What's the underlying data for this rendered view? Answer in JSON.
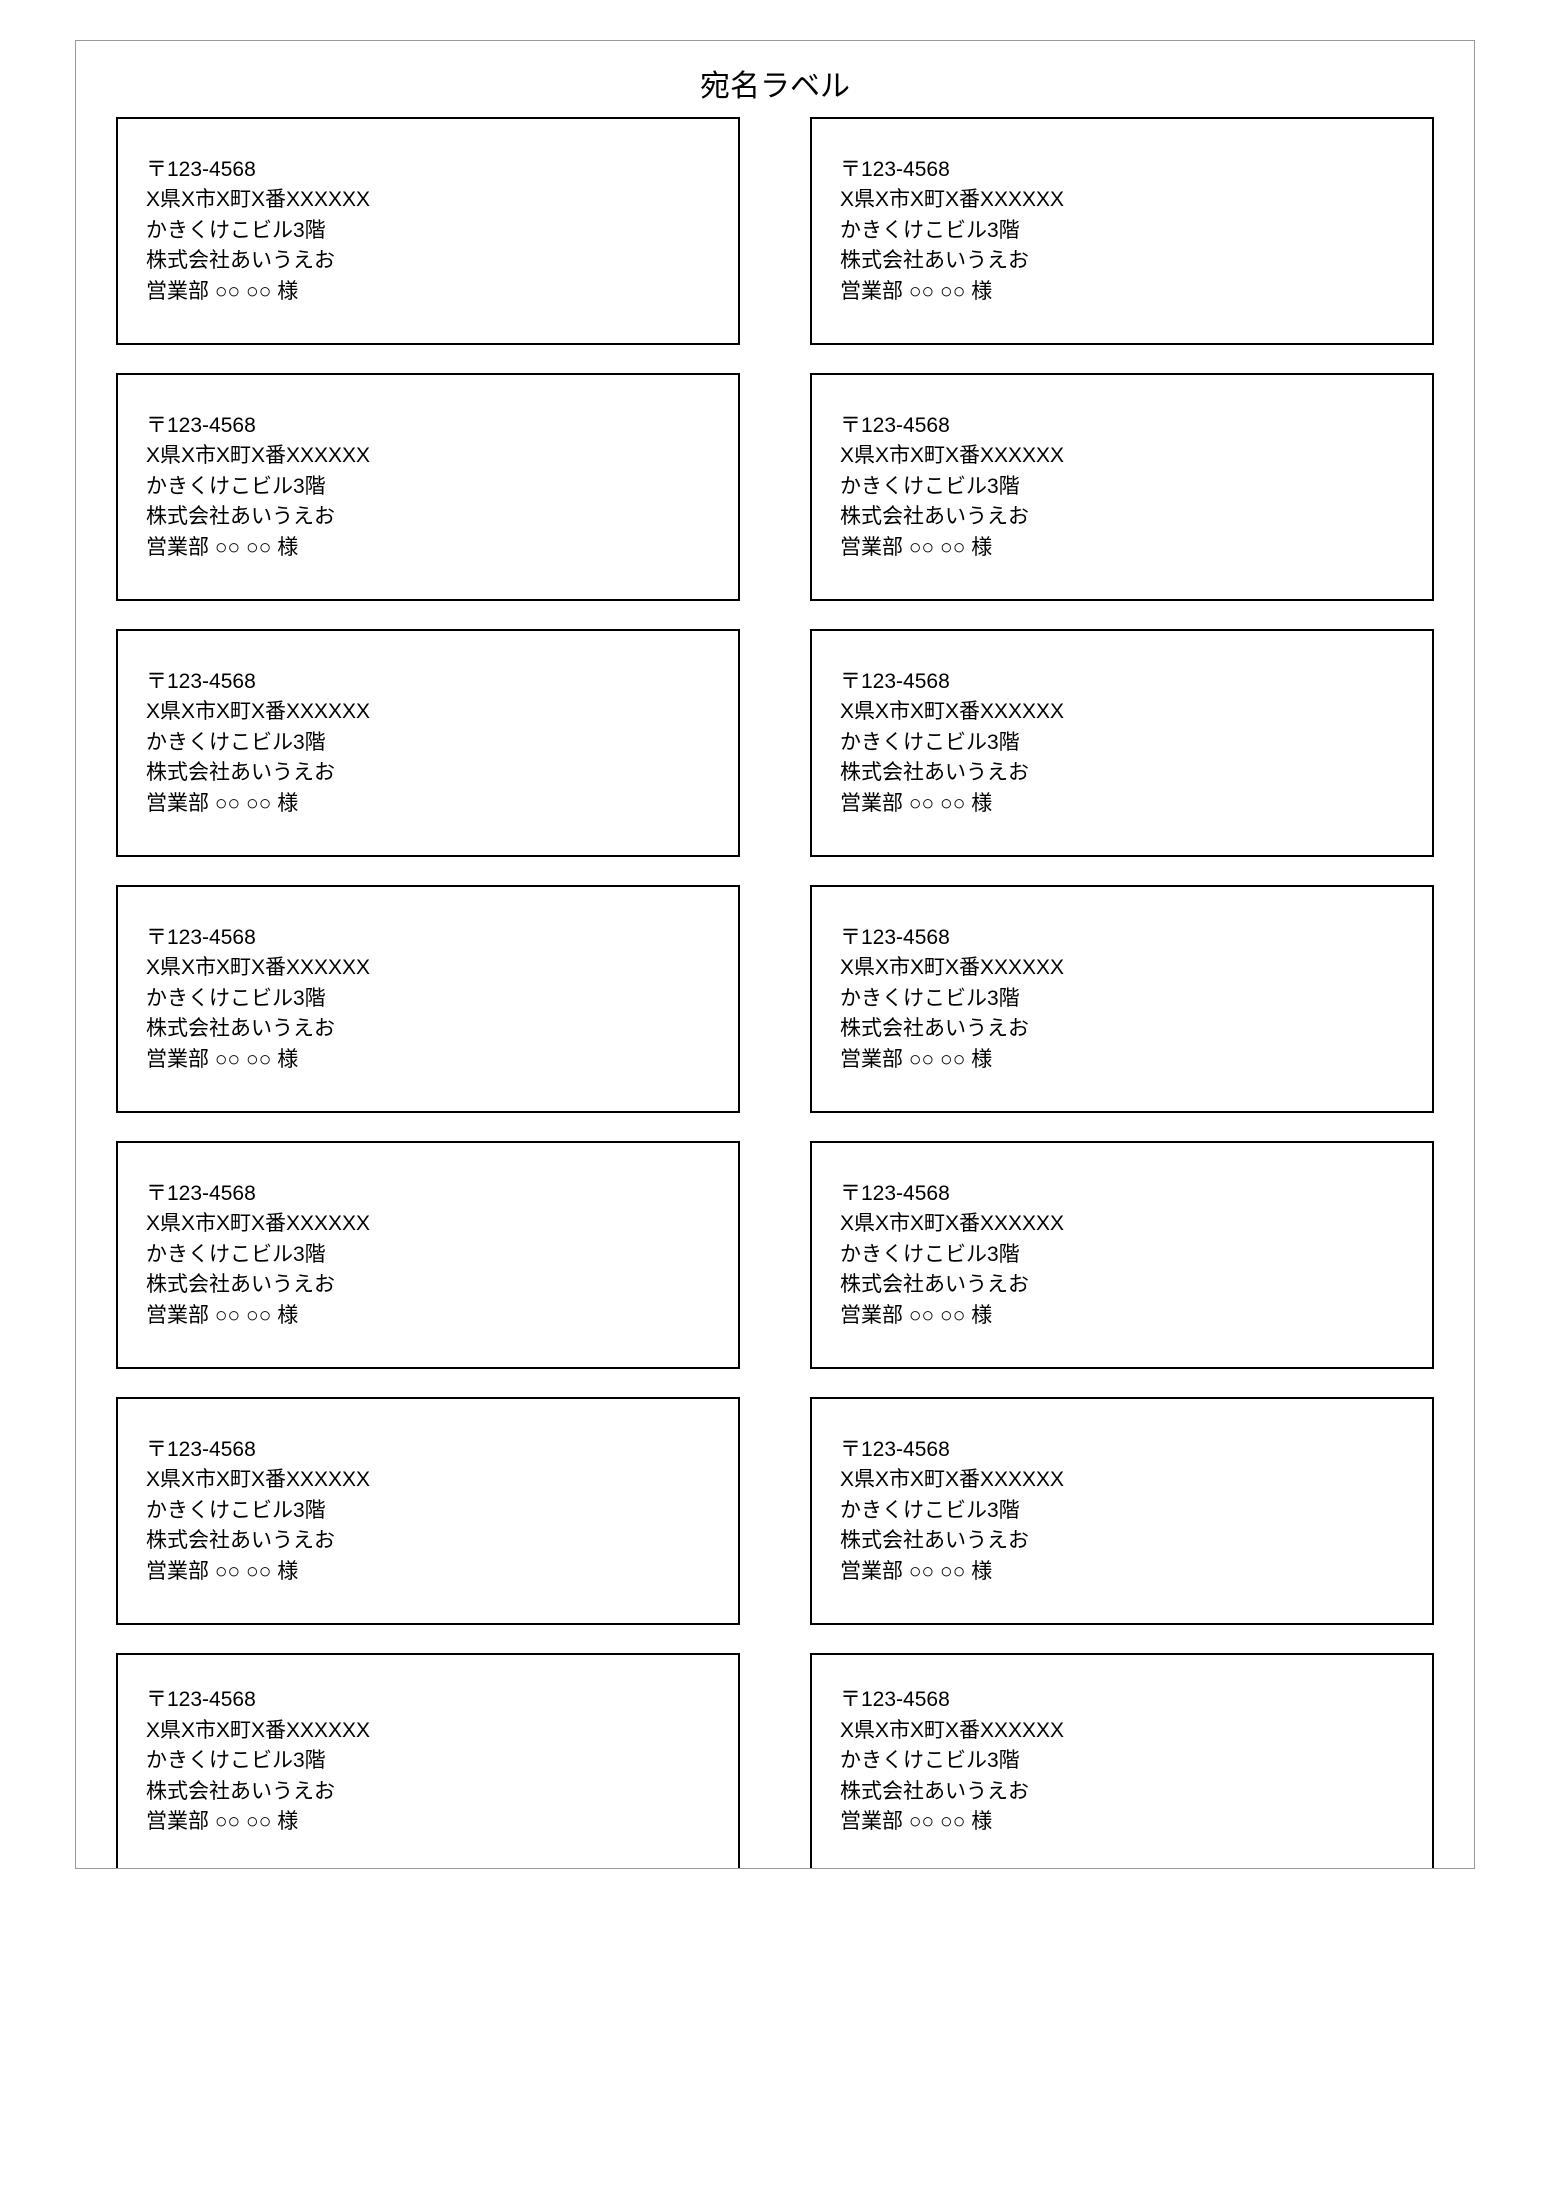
{
  "title": "宛名ラベル",
  "label_template": {
    "postal": "〒123-4568",
    "address1": "X県X市X町X番XXXXXX",
    "address2": "かきくけこビル3階",
    "company": "株式会社あいうえお",
    "recipient": "営業部 ○○ ○○ 様"
  },
  "rows": 7,
  "columns": 2
}
